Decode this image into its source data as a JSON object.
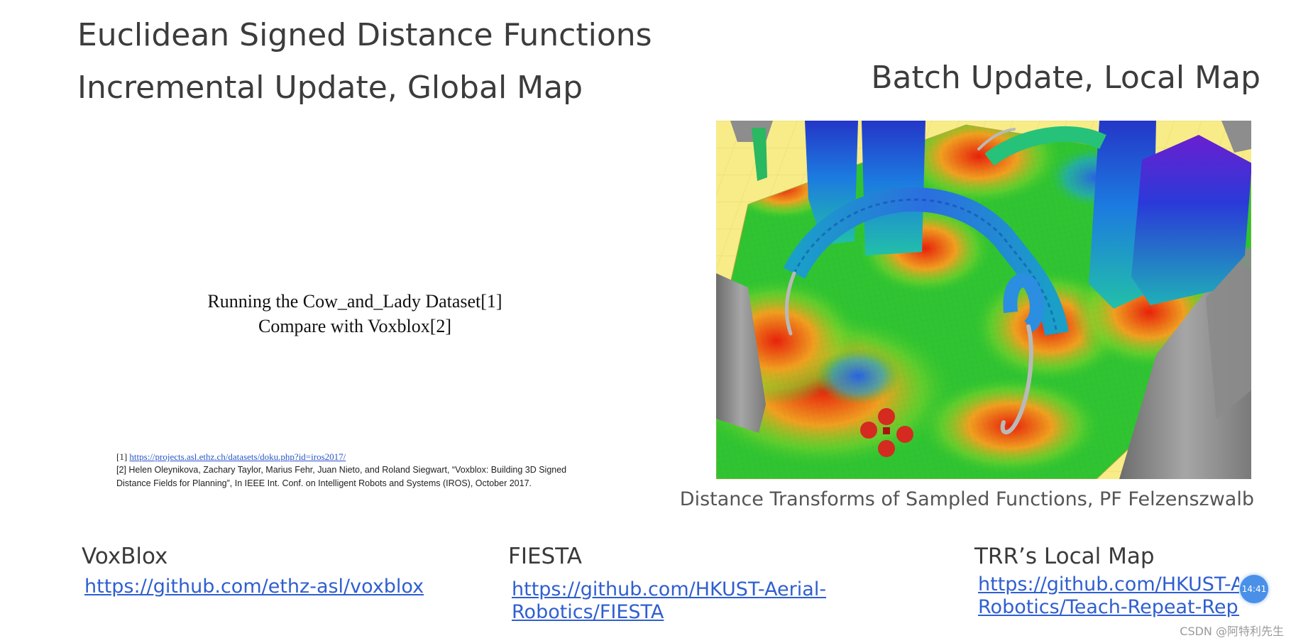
{
  "slide": {
    "title_line_1": "Euclidean Signed Distance Functions",
    "title_line_2": "Incremental Update, Global Map",
    "title_right": "Batch Update, Local Map"
  },
  "video_placeholder": {
    "line_1": "Running the Cow_and_Lady Dataset[1]",
    "line_2": "Compare with Voxblox[2]"
  },
  "references": {
    "ref_1_prefix": "[1]",
    "ref_1_link": "https://projects.asl.ethz.ch/datasets/doku.php?id=iros2017/",
    "ref_2_line_1": "[2] Helen Oleynikova, Zachary Taylor, Marius Fehr, Juan Nieto, and Roland Siegwart, “Voxblox: Building 3D Signed",
    "ref_2_line_2": "Distance Fields for Planning”, In IEEE Int. Conf. on Intelligent Robots and Systems (IROS), October 2017."
  },
  "figure": {
    "caption": "Distance Transforms of Sampled Functions, PF Felzenszwalb",
    "colors": {
      "ground": "#f7e880",
      "near": "#e02a10",
      "mid": "#2ec830",
      "far": "#2a5cd8",
      "pillar_grey": "#8f8f8f",
      "drone": "#d52a20"
    }
  },
  "sections": [
    {
      "title": "VoxBlox",
      "link": "https://github.com/ethz-asl/voxblox"
    },
    {
      "title": "FIESTA",
      "link_line_1": "https://github.com/HKUST-Aerial-",
      "link_line_2": "Robotics/FIESTA"
    },
    {
      "title": "TRR’s Local Map",
      "link_line_1": "https://github.com/HKUST-Aerial-",
      "link_line_2": "Robotics/Teach-Repeat-Replan"
    }
  ],
  "overlay": {
    "time_badge": "14:41",
    "watermark": "CSDN @阿特利先生"
  },
  "icons": {
    "time_badge": "clock-bubble-icon"
  }
}
